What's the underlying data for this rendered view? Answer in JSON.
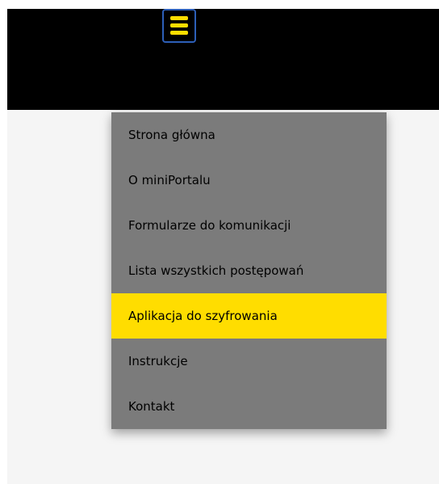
{
  "header": {
    "menu_icon": "hamburger-menu-icon",
    "background_color": "#000000",
    "icon_color": "#ffdd00",
    "icon_border_color": "#2d5fb8"
  },
  "menu": {
    "background_color": "#7b7b7b",
    "active_color": "#ffdd00",
    "items": [
      {
        "label": "Strona główna"
      },
      {
        "label": "O miniPortalu"
      },
      {
        "label": "Formularze do komunikacji"
      },
      {
        "label": "Lista wszystkich postępowań"
      },
      {
        "label": "Aplikacja do szyfrowania",
        "active": true
      },
      {
        "label": "Instrukcje"
      },
      {
        "label": "Kontakt"
      }
    ]
  }
}
